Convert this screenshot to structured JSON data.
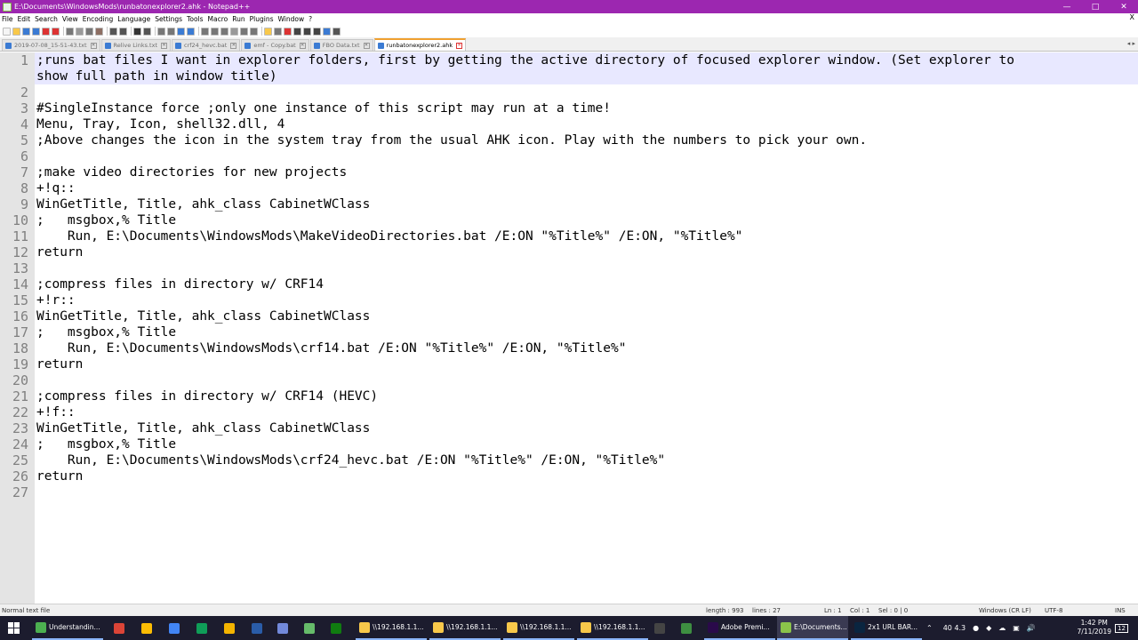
{
  "window": {
    "title": "E:\\Documents\\WindowsMods\\runbatonexplorer2.ahk - Notepad++",
    "controls": [
      "—",
      "□",
      "✕"
    ]
  },
  "menu": {
    "items": [
      "File",
      "Edit",
      "Search",
      "View",
      "Encoding",
      "Language",
      "Settings",
      "Tools",
      "Macro",
      "Run",
      "Plugins",
      "Window",
      "?"
    ],
    "close": "X"
  },
  "toolbar": {
    "icons": [
      "new-file-icon",
      "open-file-icon",
      "save-icon",
      "save-all-icon",
      "close-icon",
      "close-all-icon",
      "print-icon",
      "cut-icon",
      "copy-icon",
      "paste-icon",
      "undo-icon",
      "redo-icon",
      "find-icon",
      "replace-icon",
      "zoom-in-icon",
      "zoom-out-icon",
      "sync-v-icon",
      "sync-h-icon",
      "word-wrap-icon",
      "all-chars-icon",
      "indent-guide-icon",
      "udl-icon",
      "doc-map-icon",
      "function-list-icon",
      "folder-workspace-icon",
      "monitoring-icon",
      "record-macro-icon",
      "stop-macro-icon",
      "play-macro-icon",
      "run-macro-icon",
      "save-macro-icon",
      "spellcheck-icon"
    ]
  },
  "tabs": [
    {
      "label": "2019-07-08_15-51-43.txt",
      "active": false
    },
    {
      "label": "Relive Links.txt",
      "active": false
    },
    {
      "label": "crf24_hevc.bat",
      "active": false
    },
    {
      "label": "emf - Copy.bat",
      "active": false
    },
    {
      "label": "FBO Data.txt",
      "active": false
    },
    {
      "label": "runbatonexplorer2.ahk",
      "active": true
    }
  ],
  "tab_nav": "◂ ▸",
  "editor": {
    "lines": [
      {
        "n": "1",
        "text": ";runs bat files I want in explorer folders, first by getting the active directory of focused explorer window. (Set explorer to"
      },
      {
        "n": "",
        "text": "show full path in window title)"
      },
      {
        "n": "2",
        "text": ""
      },
      {
        "n": "3",
        "text": "#SingleInstance force ;only one instance of this script may run at a time!"
      },
      {
        "n": "4",
        "text": "Menu, Tray, Icon, shell32.dll, 4"
      },
      {
        "n": "5",
        "text": ";Above changes the icon in the system tray from the usual AHK icon. Play with the numbers to pick your own."
      },
      {
        "n": "6",
        "text": ""
      },
      {
        "n": "7",
        "text": ";make video directories for new projects"
      },
      {
        "n": "8",
        "text": "+!q::"
      },
      {
        "n": "9",
        "text": "WinGetTitle, Title, ahk_class CabinetWClass"
      },
      {
        "n": "10",
        "text": ";   msgbox,% Title"
      },
      {
        "n": "11",
        "text": "    Run, E:\\Documents\\WindowsMods\\MakeVideoDirectories.bat /E:ON \"%Title%\" /E:ON, \"%Title%\""
      },
      {
        "n": "12",
        "text": "return"
      },
      {
        "n": "13",
        "text": ""
      },
      {
        "n": "14",
        "text": ";compress files in directory w/ CRF14"
      },
      {
        "n": "15",
        "text": "+!r::"
      },
      {
        "n": "16",
        "text": "WinGetTitle, Title, ahk_class CabinetWClass"
      },
      {
        "n": "17",
        "text": ";   msgbox,% Title"
      },
      {
        "n": "18",
        "text": "    Run, E:\\Documents\\WindowsMods\\crf14.bat /E:ON \"%Title%\" /E:ON, \"%Title%\""
      },
      {
        "n": "19",
        "text": "return"
      },
      {
        "n": "20",
        "text": ""
      },
      {
        "n": "21",
        "text": ";compress files in directory w/ CRF14 (HEVC)"
      },
      {
        "n": "22",
        "text": "+!f::"
      },
      {
        "n": "23",
        "text": "WinGetTitle, Title, ahk_class CabinetWClass"
      },
      {
        "n": "24",
        "text": ";   msgbox,% Title"
      },
      {
        "n": "25",
        "text": "    Run, E:\\Documents\\WindowsMods\\crf24_hevc.bat /E:ON \"%Title%\" /E:ON, \"%Title%\""
      },
      {
        "n": "26",
        "text": "return"
      },
      {
        "n": "27",
        "text": ""
      }
    ]
  },
  "status": {
    "file_type": "Normal text file",
    "length": "length : 993",
    "lines": "lines : 27",
    "ln": "Ln : 1",
    "col": "Col : 1",
    "sel": "Sel : 0 | 0",
    "eol": "Windows (CR LF)",
    "encoding": "UTF-8",
    "mode": "INS"
  },
  "taskbar": {
    "tasks": [
      {
        "label": "Understandin...",
        "icon": "chrome-icon",
        "color": "#4caf50"
      },
      {
        "label": "",
        "icon": "chrome-icon",
        "color": "#db4437"
      },
      {
        "label": "",
        "icon": "keep-icon",
        "color": "#fbbc04"
      },
      {
        "label": "",
        "icon": "docs-icon",
        "color": "#4285f4"
      },
      {
        "label": "",
        "icon": "sheets-icon",
        "color": "#0f9d58"
      },
      {
        "label": "",
        "icon": "slides-icon",
        "color": "#f4b400"
      },
      {
        "label": "",
        "icon": "powershell-icon",
        "color": "#2a5ca8"
      },
      {
        "label": "",
        "icon": "discord-icon",
        "color": "#7289da"
      },
      {
        "label": "",
        "icon": "app-icon",
        "color": "#66bb6a"
      },
      {
        "label": "",
        "icon": "xbox-icon",
        "color": "#107c10"
      },
      {
        "label": "\\\\192.168.1.1...",
        "icon": "folder-icon",
        "color": "#f8c84a"
      },
      {
        "label": "\\\\192.168.1.1...",
        "icon": "folder-icon",
        "color": "#f8c84a"
      },
      {
        "label": "\\\\192.168.1.1...",
        "icon": "folder-icon",
        "color": "#f8c84a"
      },
      {
        "label": "\\\\192.168.1.1...",
        "icon": "folder-icon",
        "color": "#f8c84a"
      },
      {
        "label": "",
        "icon": "obs-icon",
        "color": "#444444"
      },
      {
        "label": "",
        "icon": "rl-icon",
        "color": "#3e8e41"
      },
      {
        "label": "Adobe Premi...",
        "icon": "premiere-icon",
        "color": "#2a0a4a"
      },
      {
        "label": "E:\\Documents...",
        "icon": "notepadpp-icon",
        "color": "#8bc34a"
      },
      {
        "label": "2x1 URL BAR...",
        "icon": "photoshop-icon",
        "color": "#0a2540"
      }
    ],
    "tray": {
      "values": "40  4.3",
      "time": "1:42 PM",
      "date": "7/11/2019",
      "notifications": "12"
    }
  }
}
